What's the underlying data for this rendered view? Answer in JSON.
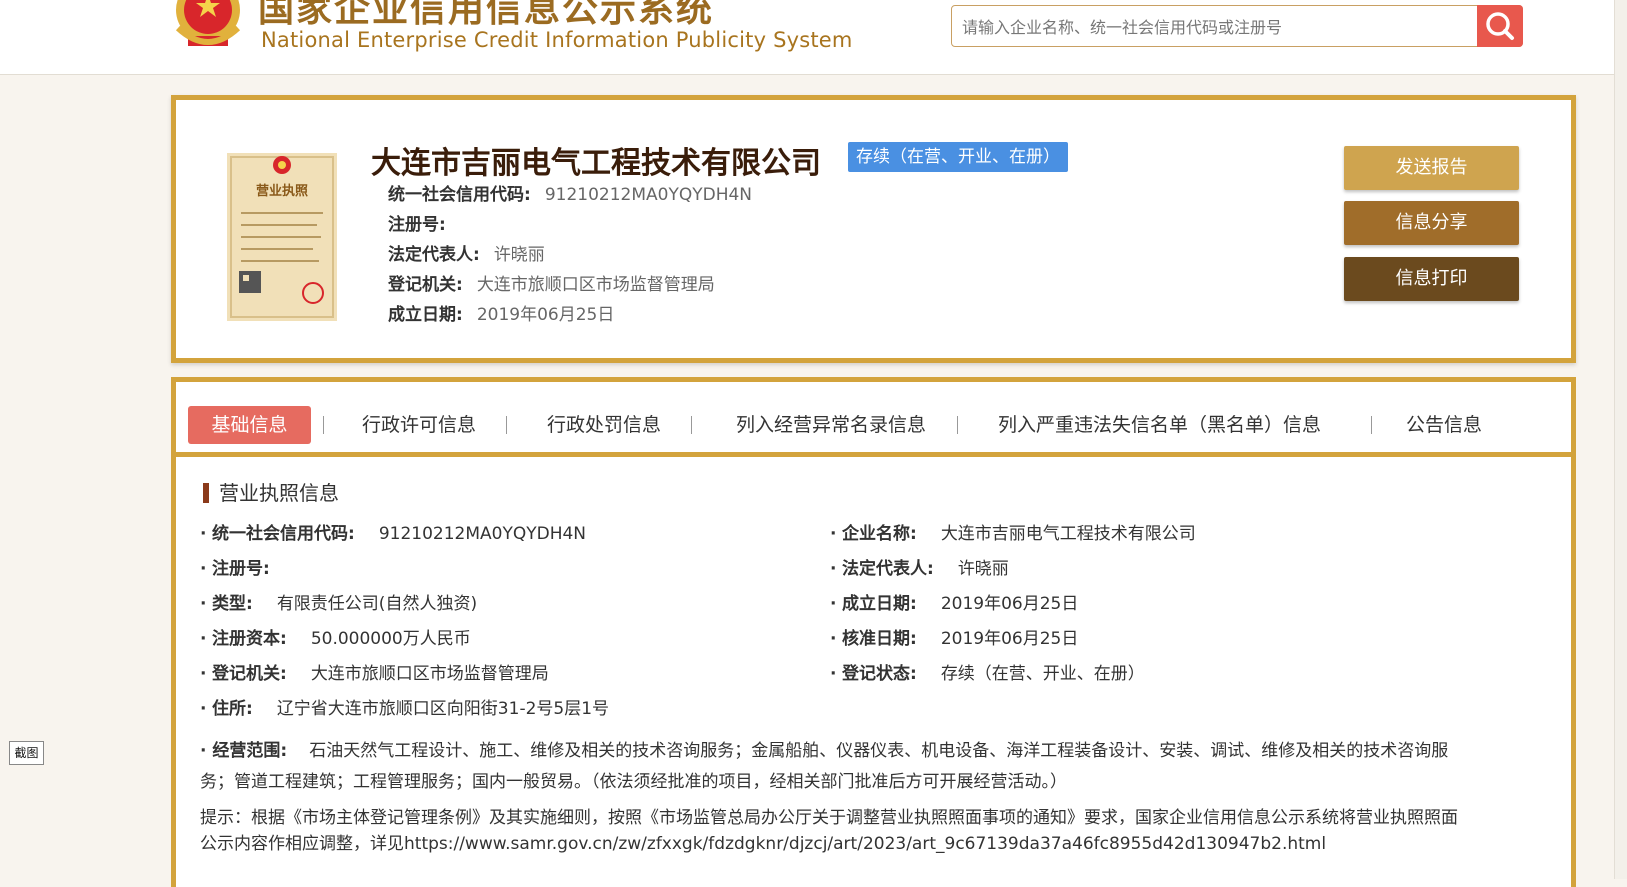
{
  "header": {
    "site_title_cn": "国家企业信用信息公示系统",
    "site_title_en": "National Enterprise Credit Information Publicity System",
    "search_placeholder": "请输入企业名称、统一社会信用代码或注册号",
    "search_value": "",
    "search_icon": "magnifier-icon",
    "emblem_icon": "national-emblem-icon"
  },
  "company": {
    "name": "大连市吉丽电气工程技术有限公司",
    "status": "存续（在营、开业、在册）",
    "thumbnail_icon": "business-license-icon",
    "thumbnail_text": "营业执照",
    "fields": [
      {
        "label": "统一社会信用代码:",
        "value": "91210212MA0YQYDH4N"
      },
      {
        "label": "注册号:",
        "value": ""
      },
      {
        "label": "法定代表人:",
        "value": "许晓丽"
      },
      {
        "label": "登记机关:",
        "value": "大连市旅顺口区市场监督管理局"
      },
      {
        "label": "成立日期:",
        "value": "2019年06月25日"
      }
    ],
    "buttons": {
      "send": "发送报告",
      "share": "信息分享",
      "print": "信息打印"
    }
  },
  "tabs": [
    {
      "label": "基础信息",
      "active": true
    },
    {
      "label": "行政许可信息",
      "active": false
    },
    {
      "label": "行政处罚信息",
      "active": false
    },
    {
      "label": "列入经营异常名录信息",
      "active": false
    },
    {
      "label": "列入严重违法失信名单（黑名单）信息",
      "active": false
    },
    {
      "label": "公告信息",
      "active": false
    }
  ],
  "license": {
    "section_title": "营业执照信息",
    "left": [
      {
        "label": "统一社会信用代码:",
        "value": "91210212MA0YQYDH4N"
      },
      {
        "label": "注册号:",
        "value": ""
      },
      {
        "label": "类型:",
        "value": "有限责任公司(自然人独资)"
      },
      {
        "label": "注册资本:",
        "value": "50.000000万人民币"
      },
      {
        "label": "登记机关:",
        "value": "大连市旅顺口区市场监督管理局"
      },
      {
        "label": "住所:",
        "value": "辽宁省大连市旅顺口区向阳街31-2号5层1号"
      }
    ],
    "right": [
      {
        "label": "企业名称:",
        "value": "大连市吉丽电气工程技术有限公司"
      },
      {
        "label": "法定代表人:",
        "value": "许晓丽"
      },
      {
        "label": "成立日期:",
        "value": "2019年06月25日"
      },
      {
        "label": "核准日期:",
        "value": "2019年06月25日"
      },
      {
        "label": "登记状态:",
        "value": "存续（在营、开业、在册）"
      }
    ],
    "scope_label": "经营范围:",
    "scope_value": "石油天然气工程设计、施工、维修及相关的技术咨询服务；金属船舶、仪器仪表、机电设备、海洋工程装备设计、安装、调试、维修及相关的技术咨询服务；管道工程建筑；工程管理服务；国内一般贸易。（依法须经批准的项目，经相关部门批准后方可开展经营活动。）",
    "note": "提示：根据《市场主体登记管理条例》及其实施细则，按照《市场监管总局办公厅关于调整营业执照照面事项的通知》要求，国家企业信用信息公示系统将营业执照照面公示内容作相应调整，详见https://www.samr.gov.cn/zw/zfxxgk/fdzdgknr/djzcj/art/2023/art_9c67139da37a46fc8955d42d130947b2.html"
  },
  "tool": {
    "snip_label": "截图"
  },
  "colors": {
    "gold_border": "#d3a33c",
    "search_button": "#e8584d",
    "status_badge": "#4a90e2",
    "active_tab": "#e66b60",
    "btn_send": "#cfa44f",
    "btn_share": "#a06d2a",
    "btn_print": "#6b4a1e"
  }
}
